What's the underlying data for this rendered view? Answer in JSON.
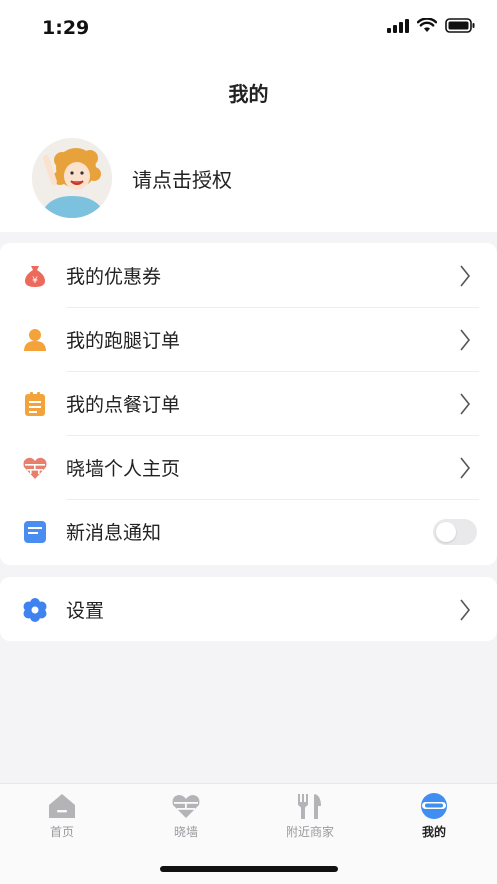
{
  "status_bar": {
    "time": "1:29"
  },
  "header": {
    "title": "我的"
  },
  "profile": {
    "auth_prompt": "请点击授权"
  },
  "menu": {
    "items": [
      {
        "label": "我的优惠券",
        "icon": "money-bag-icon",
        "color": "#ec6a5c"
      },
      {
        "label": "我的跑腿订单",
        "icon": "person-icon",
        "color": "#f4a23a"
      },
      {
        "label": "我的点餐订单",
        "icon": "clipboard-icon",
        "color": "#f4a23a"
      },
      {
        "label": "晓墙个人主页",
        "icon": "heart-brick-icon",
        "color": "#e77f6c"
      },
      {
        "label": "新消息通知",
        "icon": "message-icon",
        "color": "#4a8df0",
        "toggle": false
      }
    ]
  },
  "settings": {
    "label": "设置",
    "icon": "gear-icon",
    "color": "#3e83f0"
  },
  "tabbar": {
    "tabs": [
      {
        "label": "首页",
        "icon": "home-icon",
        "active": false
      },
      {
        "label": "晓墙",
        "icon": "heart-wall-icon",
        "active": false
      },
      {
        "label": "附近商家",
        "icon": "fork-knife-icon",
        "active": false
      },
      {
        "label": "我的",
        "icon": "mine-icon",
        "active": true
      }
    ],
    "active_color": "#3f8ef0",
    "inactive_color": "#b4b4b8"
  }
}
